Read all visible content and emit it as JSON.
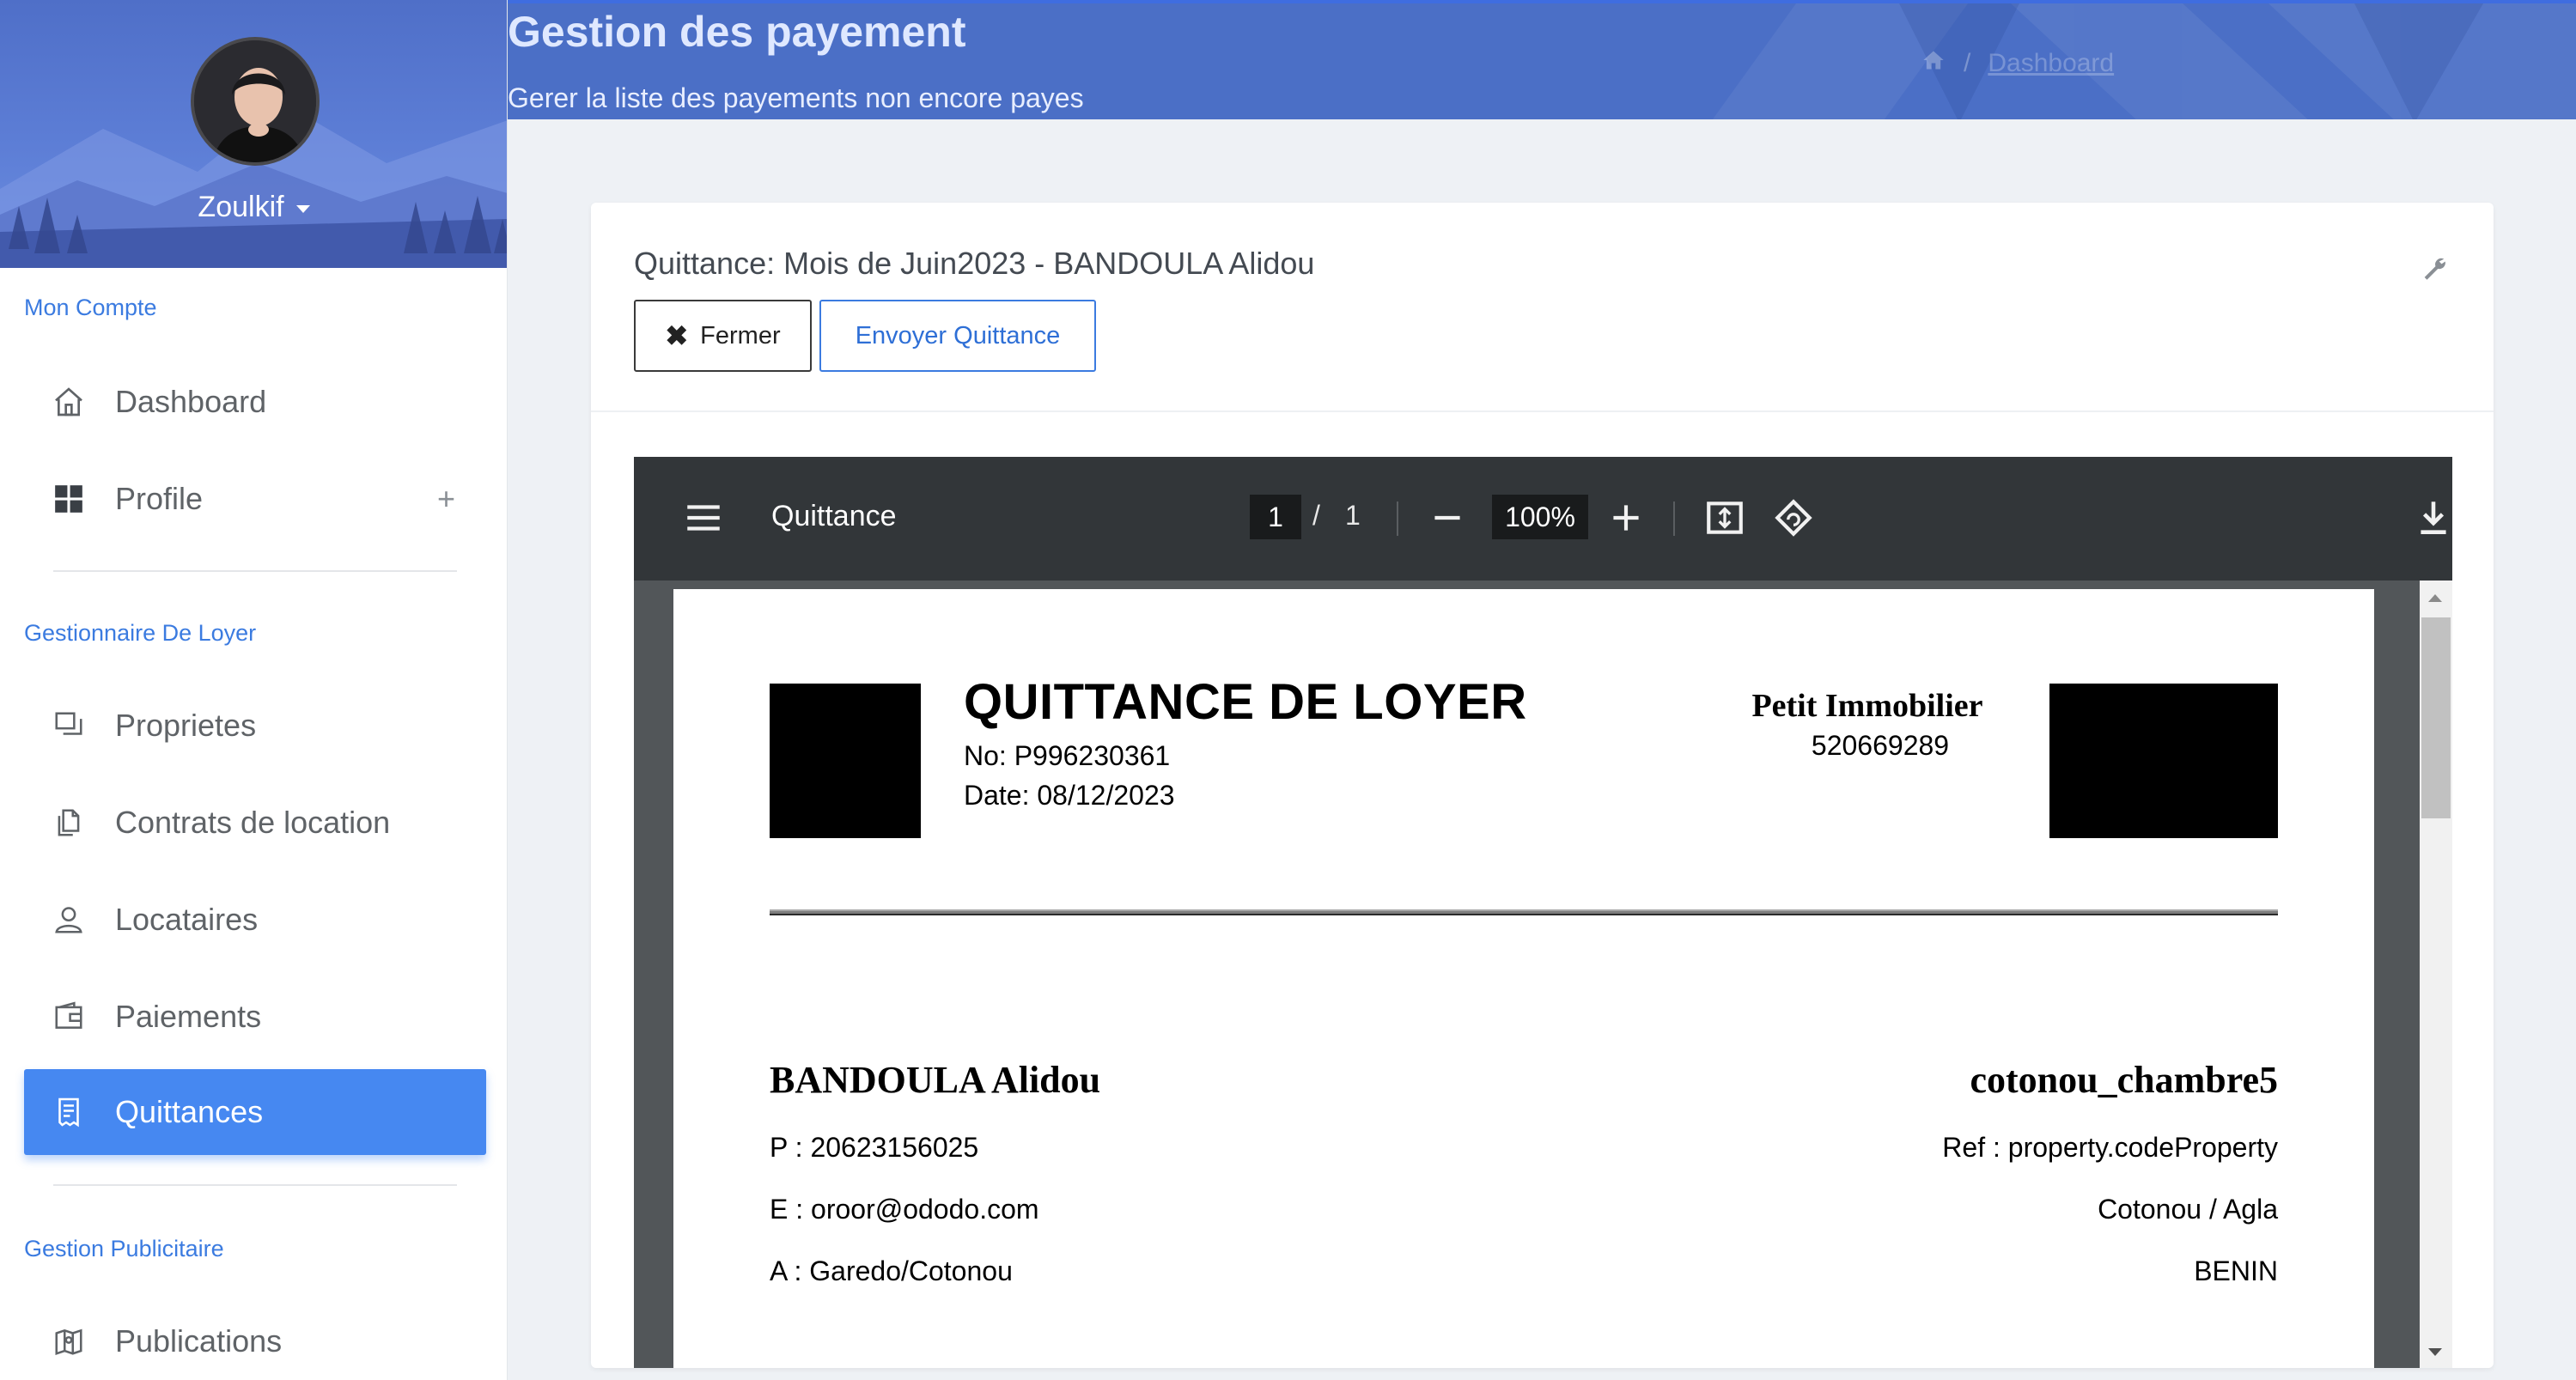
{
  "sidebar": {
    "user": {
      "name": "Zoulkif"
    },
    "sections": [
      {
        "label": "Mon Compte"
      },
      {
        "label": "Gestionnaire De Loyer"
      },
      {
        "label": "Gestion Publicitaire"
      }
    ],
    "items": [
      {
        "label": "Dashboard",
        "icon": "home-icon"
      },
      {
        "label": "Profile",
        "icon": "grid-icon",
        "expand": "+"
      },
      {
        "label": "Proprietes",
        "icon": "windows-icon"
      },
      {
        "label": "Contrats de location",
        "icon": "documents-icon"
      },
      {
        "label": "Locataires",
        "icon": "user-icon"
      },
      {
        "label": "Paiements",
        "icon": "wallet-icon"
      },
      {
        "label": "Quittances",
        "icon": "receipt-icon",
        "active": true
      },
      {
        "label": "Publications",
        "icon": "map-icon"
      }
    ]
  },
  "header": {
    "title": "Gestion des payement",
    "subtitle": "Gerer la liste des payements non encore payes",
    "breadcrumb": {
      "separator": "/",
      "link": "Dashboard"
    }
  },
  "card": {
    "title": "Quittance: Mois de Juin2023 - BANDOULA Alidou",
    "close_label": "Fermer",
    "send_label": "Envoyer Quittance"
  },
  "viewer": {
    "doc_name": "Quittance",
    "page_current": "1",
    "page_separator": "/",
    "page_total": "1",
    "zoom": "100%"
  },
  "receipt": {
    "title": "QUITTANCE DE LOYER",
    "number": "No: P996230361",
    "date": "Date: 08/12/2023",
    "company_name": "Petit Immobilier",
    "company_phone": "520669289",
    "tenant_name": "BANDOULA Alidou",
    "tenant_phone": "P : 20623156025",
    "tenant_email": "E : oroor@ododo.com",
    "tenant_address": "A : Garedo/Cotonou",
    "property_name": "cotonou_chambre5",
    "property_ref": "Ref : property.codeProperty",
    "property_city": "Cotonou / Agla",
    "property_country": "BENIN"
  },
  "colors": {
    "accent": "#4688f1",
    "header_bg": "#4b6fc6",
    "section_label": "#3b7be0",
    "toolbar_bg": "#323639"
  }
}
